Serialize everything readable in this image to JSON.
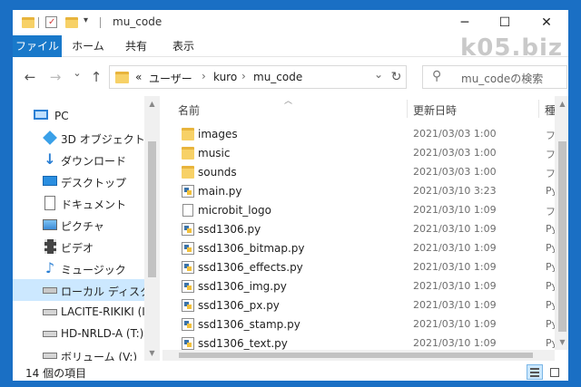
{
  "window": {
    "title": "mu_code",
    "controls": {
      "minimize": "─",
      "maximize": "☐",
      "close": "✕"
    }
  },
  "ribbon": {
    "tabs": [
      "ファイル",
      "ホーム",
      "共有",
      "表示"
    ]
  },
  "watermark": "k05.biz",
  "nav": {
    "back": "←",
    "forward": "→",
    "recent": "⌄",
    "up": "↑",
    "refresh": "↻",
    "address": {
      "overflow": "«",
      "parts": [
        "ユーザー",
        "kuro",
        "mu_code"
      ],
      "dropdown": "⌄"
    },
    "search_placeholder": "mu_codeの検索"
  },
  "sidebar": {
    "items": [
      {
        "label": "PC",
        "icon": "pc-icon"
      },
      {
        "label": "3D オブジェクト",
        "icon": "3d-objects-icon"
      },
      {
        "label": "ダウンロード",
        "icon": "download-icon"
      },
      {
        "label": "デスクトップ",
        "icon": "desktop-icon"
      },
      {
        "label": "ドキュメント",
        "icon": "documents-icon"
      },
      {
        "label": "ピクチャ",
        "icon": "pictures-icon"
      },
      {
        "label": "ビデオ",
        "icon": "videos-icon"
      },
      {
        "label": "ミュージック",
        "icon": "music-icon"
      },
      {
        "label": "ローカル ディスク (C:",
        "icon": "local-disk-icon",
        "active": true
      },
      {
        "label": "LACITE-RIKIKI (I:)",
        "icon": "drive-icon"
      },
      {
        "label": "HD-NRLD-A (T:)",
        "icon": "drive-icon"
      },
      {
        "label": "ボリューム (V:)",
        "icon": "drive-icon"
      }
    ]
  },
  "columns": {
    "name": "名前",
    "date": "更新日時",
    "type": "種"
  },
  "files": [
    {
      "name": "images",
      "date": "2021/03/03 1:00",
      "type": "フ",
      "icon": "folder-icon"
    },
    {
      "name": "music",
      "date": "2021/03/03 1:00",
      "type": "フ",
      "icon": "folder-icon"
    },
    {
      "name": "sounds",
      "date": "2021/03/03 1:00",
      "type": "フ",
      "icon": "folder-icon"
    },
    {
      "name": "main.py",
      "date": "2021/03/10 3:23",
      "type": "Py",
      "icon": "python-file-icon"
    },
    {
      "name": "microbit_logo",
      "date": "2021/03/10 1:09",
      "type": "フ",
      "icon": "file-icon"
    },
    {
      "name": "ssd1306.py",
      "date": "2021/03/10 1:09",
      "type": "Py",
      "icon": "python-file-icon"
    },
    {
      "name": "ssd1306_bitmap.py",
      "date": "2021/03/10 1:09",
      "type": "Py",
      "icon": "python-file-icon"
    },
    {
      "name": "ssd1306_effects.py",
      "date": "2021/03/10 1:09",
      "type": "Py",
      "icon": "python-file-icon"
    },
    {
      "name": "ssd1306_img.py",
      "date": "2021/03/10 1:09",
      "type": "Py",
      "icon": "python-file-icon"
    },
    {
      "name": "ssd1306_px.py",
      "date": "2021/03/10 1:09",
      "type": "Py",
      "icon": "python-file-icon"
    },
    {
      "name": "ssd1306_stamp.py",
      "date": "2021/03/10 1:09",
      "type": "Py",
      "icon": "python-file-icon"
    },
    {
      "name": "ssd1306_text.py",
      "date": "2021/03/10 1:09",
      "type": "Py",
      "icon": "python-file-icon"
    }
  ],
  "status": {
    "item_count": "14 個の項目"
  },
  "colors": {
    "accent": "#1979ca",
    "selection": "#cce8ff",
    "folder": "#f7d167"
  }
}
